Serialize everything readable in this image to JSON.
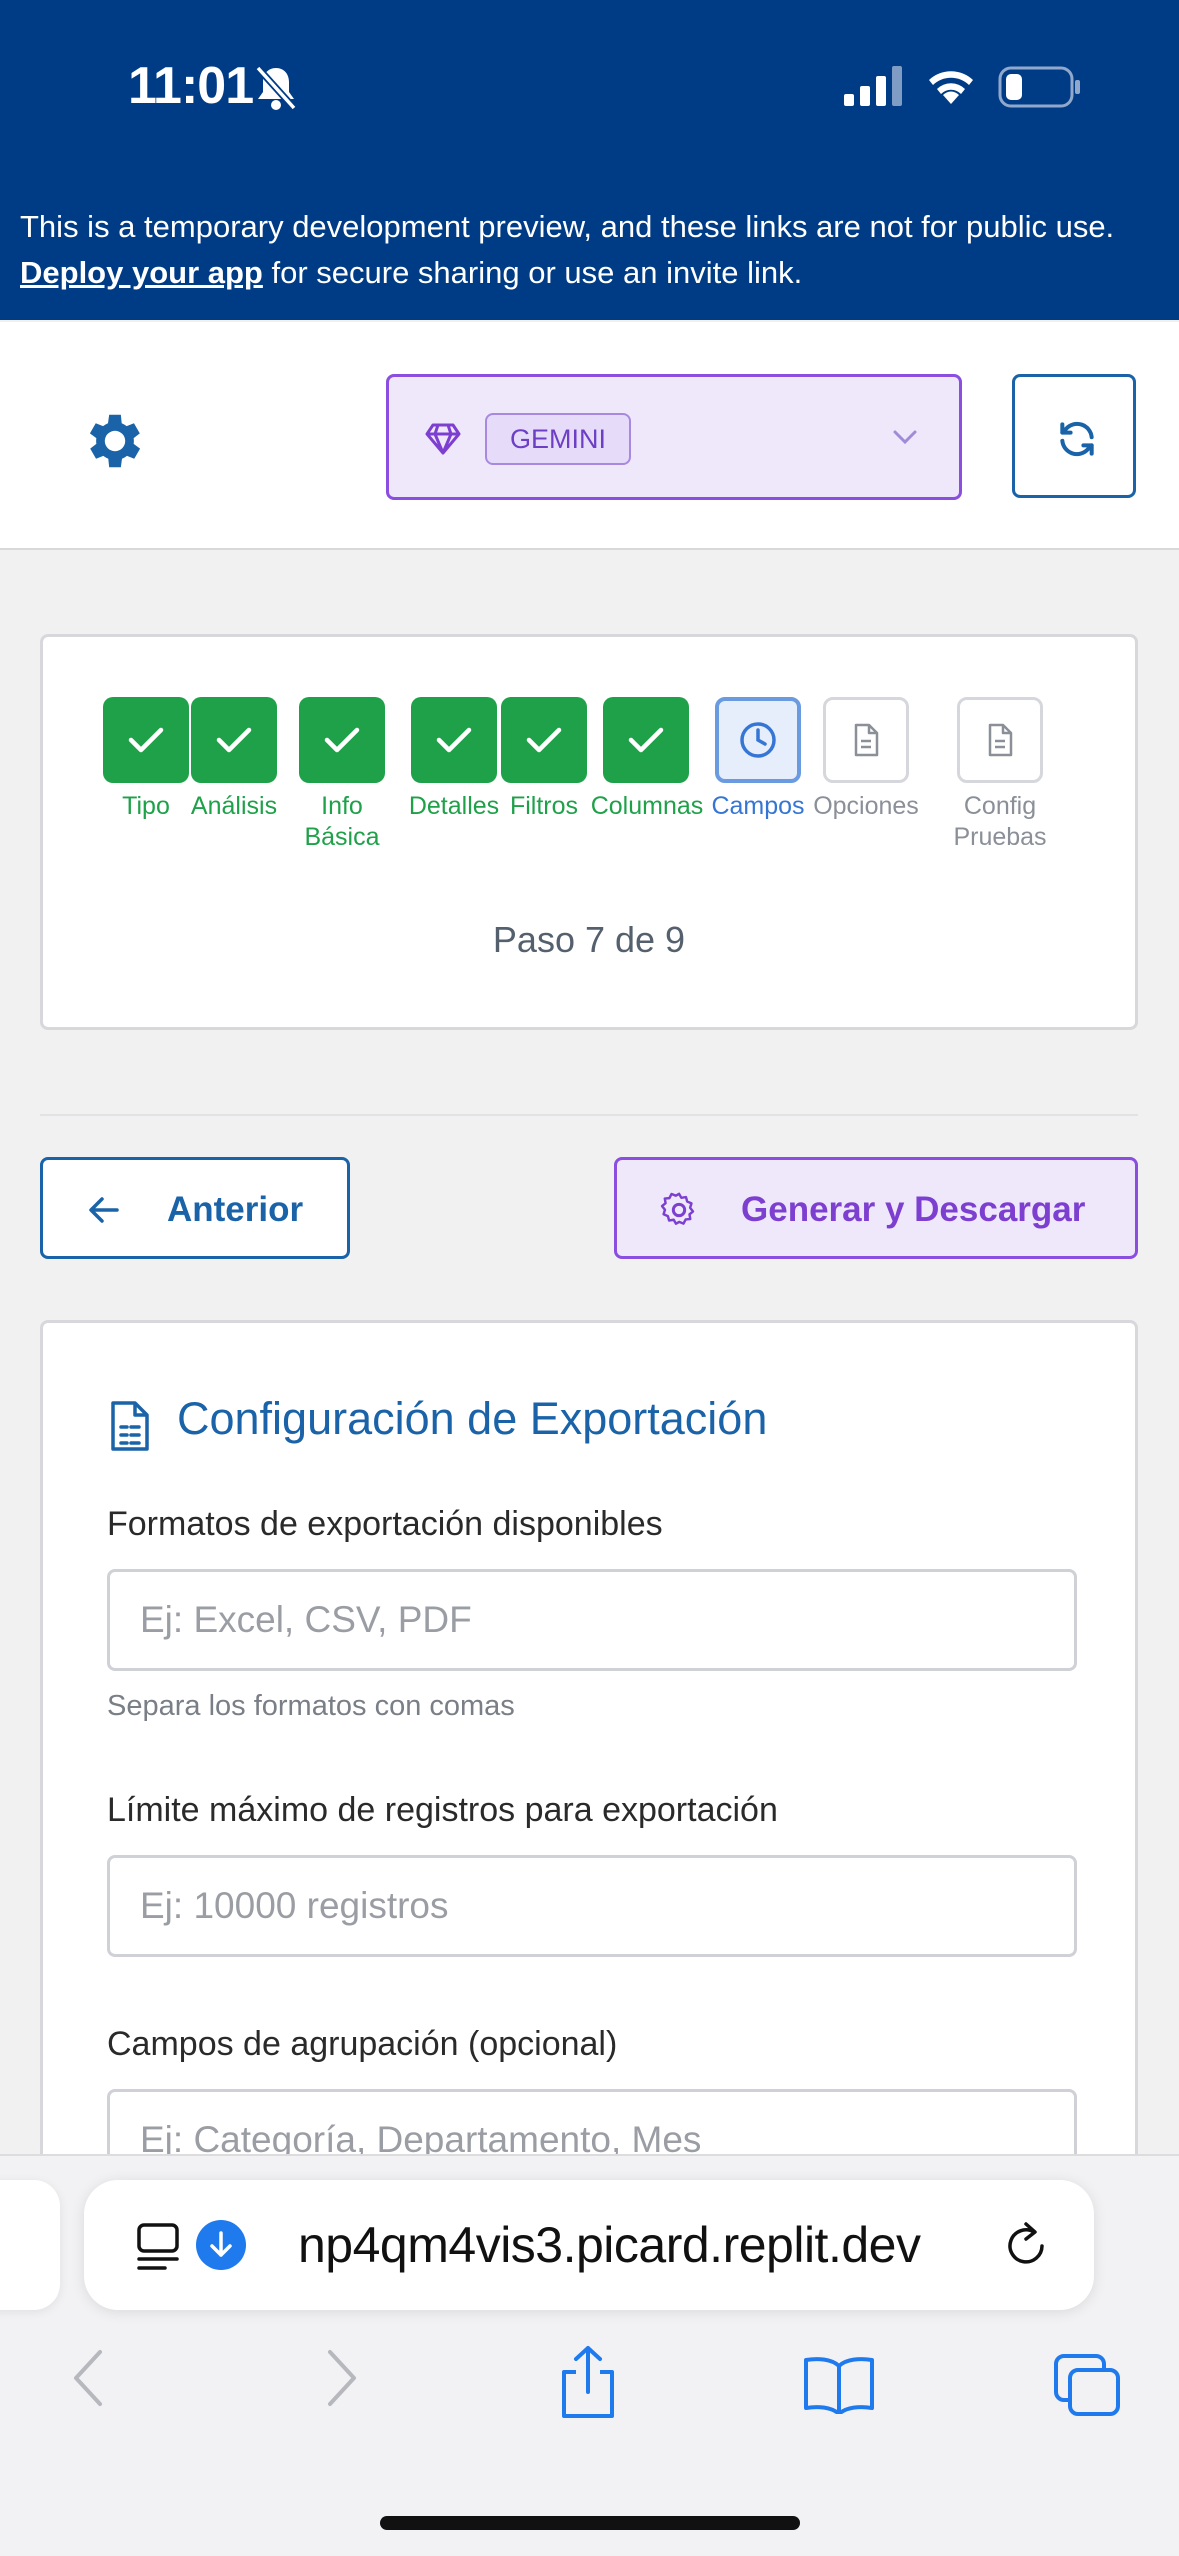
{
  "status_bar": {
    "time": "11:01"
  },
  "banner": {
    "text_before": "This is a temporary development preview, and these links are not for public use. ",
    "link": "Deploy your app",
    "text_after": " for secure sharing or use an invite link."
  },
  "header": {
    "model_badge": "GEMINI"
  },
  "stepper": {
    "steps": [
      {
        "label": "Tipo",
        "state": "done"
      },
      {
        "label": "Análisis",
        "state": "done"
      },
      {
        "label": "Info\nBásica",
        "state": "done"
      },
      {
        "label": "Detalles",
        "state": "done"
      },
      {
        "label": "Filtros",
        "state": "done"
      },
      {
        "label": "Columnas",
        "state": "done"
      },
      {
        "label": "Campos",
        "state": "current"
      },
      {
        "label": "Opciones",
        "state": "pending"
      },
      {
        "label": "Config\nPruebas",
        "state": "pending"
      }
    ],
    "counter": "Paso 7 de 9"
  },
  "nav": {
    "prev_label": "Anterior",
    "generate_label": "Generar y Descargar"
  },
  "form": {
    "title": "Configuración de Exportación",
    "formats_label": "Formatos de exportación disponibles",
    "formats_placeholder": "Ej: Excel, CSV, PDF",
    "formats_help": "Separa los formatos con comas",
    "limit_label": "Límite máximo de registros para exportación",
    "limit_placeholder": "Ej: 10000 registros",
    "group_label": "Campos de agrupación (opcional)",
    "group_placeholder": "Ej: Categoría, Departamento, Mes"
  },
  "browser": {
    "url": "np4qm4vis3.picard.replit.dev"
  },
  "colors": {
    "brand_blue": "#003c86",
    "success": "#1fa14a",
    "accent_purple": "#8a4ee0",
    "link_blue": "#1a63a8"
  }
}
